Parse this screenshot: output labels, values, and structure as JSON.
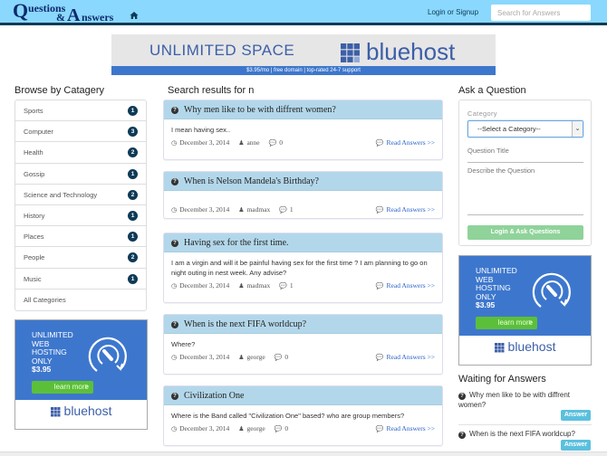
{
  "navbar": {
    "logo_parts": [
      "Q",
      "uestions",
      "&",
      "A",
      "nswers"
    ],
    "logo_alt": "Questions & Answers",
    "home_icon": "home-icon",
    "login_label": "Login or Signup",
    "search_placeholder": "Search for Answers"
  },
  "top_ad": {
    "headline": "UNLIMITED SPACE",
    "brand": "bluehost",
    "strip": "$3.95/mo | free domain | top-rated 24-7 support"
  },
  "sidebar": {
    "title": "Browse by Catagery",
    "categories": [
      {
        "label": "Sports",
        "count": "1"
      },
      {
        "label": "Computer",
        "count": "3"
      },
      {
        "label": "Health",
        "count": "2"
      },
      {
        "label": "Gossip",
        "count": "1"
      },
      {
        "label": "Science and Technology",
        "count": "2"
      },
      {
        "label": "History",
        "count": "1"
      },
      {
        "label": "Places",
        "count": "1"
      },
      {
        "label": "People",
        "count": "2"
      },
      {
        "label": "Music",
        "count": "1"
      },
      {
        "label": "All Categories",
        "count": null
      }
    ],
    "ad": {
      "lines": [
        "UNLIMITED",
        "WEB",
        "HOSTING",
        "ONLY"
      ],
      "price": "$3.95",
      "cta": "learn more",
      "cta_arrow": ">",
      "brand": "bluehost"
    }
  },
  "main": {
    "title": "Search results for  n",
    "read_label": "Read Answers >>",
    "questions": [
      {
        "title": "Why men like to be with diffrent women?",
        "body": "I mean having sex..",
        "date": "December 3, 2014",
        "author": "anne",
        "answers": "0"
      },
      {
        "title": "When is Nelson Mandela's Birthday?",
        "body": "",
        "date": "December 3, 2014",
        "author": "madmax",
        "answers": "1"
      },
      {
        "title": "Having sex for the first time.",
        "body": "I am a virgin and will it be painful having sex for the first time ? I am planning to go on night outing in nest week. Any advise?",
        "date": "December 3, 2014",
        "author": "madmax",
        "answers": "1"
      },
      {
        "title": "When is the next FIFA worldcup?",
        "body": "Where?",
        "date": "December 3, 2014",
        "author": "george",
        "answers": "0"
      },
      {
        "title": "Civilization One",
        "body": "Where is the Band called \"Civilization One\" based? who are group members?",
        "date": "December 3, 2014",
        "author": "george",
        "answers": "0"
      }
    ]
  },
  "ask": {
    "title": "Ask a Question",
    "category_label": "Category",
    "category_selected": "--Select a Category--",
    "title_placeholder": "Question Title",
    "describe_placeholder": "Describe the Question",
    "submit_label": "Login & Ask Questions"
  },
  "right_ad": {
    "lines": [
      "UNLIMITED",
      "WEB",
      "HOSTING",
      "ONLY"
    ],
    "price": "$3.95",
    "cta": "learn more",
    "cta_arrow": ">",
    "brand": "bluehost"
  },
  "waiting": {
    "title": "Waiting for Answers",
    "answer_label": "Answer",
    "items": [
      {
        "text": "Why men like to be with diffrent women?"
      },
      {
        "text": "When is the next FIFA worldcup?"
      }
    ]
  },
  "colors": {
    "navbar_bg": "#8ad8fd",
    "navbar_border": "#0d3a57",
    "badge": "#0d3a57",
    "card_header": "#b3d7ea",
    "link": "#2a62c9",
    "answer_button": "#5bc0de",
    "ask_button": "#8fd39a",
    "ad_blue": "#3d77cd"
  }
}
